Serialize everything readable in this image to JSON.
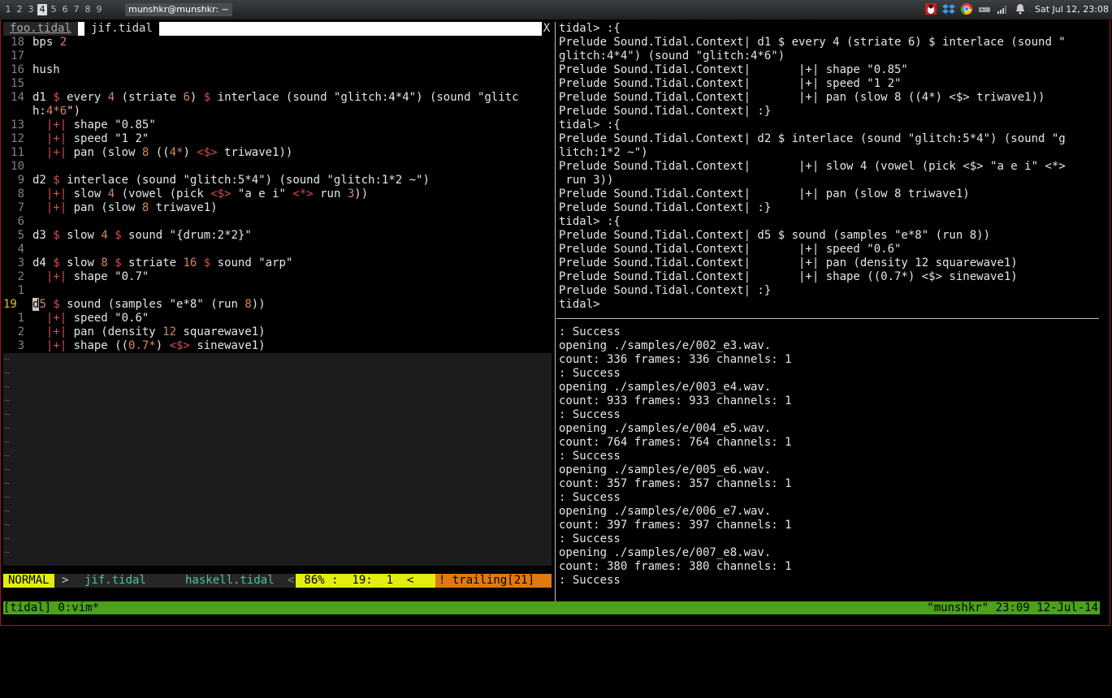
{
  "panel": {
    "workspaces": [
      "1",
      "2",
      "3",
      "4",
      "5",
      "6",
      "7",
      "8",
      "9"
    ],
    "active_workspace": "4",
    "window_title": "munshkr@munshkr: ~",
    "clock": "Sat Jul 12, 23:08",
    "tray_icons": [
      "tux-icon",
      "dropbox-icon",
      "chrome-icon",
      "drive-icon",
      "network-icon",
      "bell-icon"
    ]
  },
  "vim": {
    "tabs": [
      "foo.tidal",
      "jif.tidal"
    ],
    "close": "X",
    "status": {
      "mode": "NORMAL",
      "sep1": ">",
      "file1": "jif.tidal",
      "file2": "haskell.tidal",
      "sep2": "<",
      "position": " 86% :  19:  1  <",
      "warning": "! trailing[21]"
    }
  },
  "tmux": {
    "left": "[tidal] 0:vim*",
    "right": "\"munshkr\" 23:09 12-Jul-14"
  },
  "colors": {
    "status_yellow": "#e2ee10",
    "status_orange": "#e07a10",
    "tmux_green": "#4ca21a",
    "frame_red": "#a4161a"
  },
  "code_lines": [
    {
      "n": "18",
      "t": "bps 2"
    },
    {
      "n": "17",
      "t": ""
    },
    {
      "n": "16",
      "t": "hush"
    },
    {
      "n": "15",
      "t": ""
    },
    {
      "n": "14",
      "t": "d1 $ every 4 (striate 6) $ interlace (sound \"glitch:4*4\") (sound \"glitc"
    },
    {
      "n": "",
      "t": "h:4*6\")"
    },
    {
      "n": "13",
      "t": "  |+| shape \"0.85\""
    },
    {
      "n": "12",
      "t": "  |+| speed \"1 2\""
    },
    {
      "n": "11",
      "t": "  |+| pan (slow 8 ((4*) <$> triwave1))"
    },
    {
      "n": "10",
      "t": ""
    },
    {
      "n": "9",
      "t": "d2 $ interlace (sound \"glitch:5*4\") (sound \"glitch:1*2 ~\")"
    },
    {
      "n": "8",
      "t": "  |+| slow 4 (vowel (pick <$> \"a e i\" <*> run 3))"
    },
    {
      "n": "7",
      "t": "  |+| pan (slow 8 triwave1)"
    },
    {
      "n": "6",
      "t": ""
    },
    {
      "n": "5",
      "t": "d3 $ slow 4 $ sound \"{drum:2*2}\""
    },
    {
      "n": "4",
      "t": ""
    },
    {
      "n": "3",
      "t": "d4 $ slow 8 $ striate 16 $ sound \"arp\""
    },
    {
      "n": "2",
      "t": "  |+| shape \"0.7\""
    },
    {
      "n": "1",
      "t": ""
    },
    {
      "n": "19",
      "t": "d5 $ sound (samples \"e*8\" (run 8))"
    },
    {
      "n": "1",
      "t": "  |+| speed \"0.6\""
    },
    {
      "n": "2",
      "t": "  |+| pan (density 12 squarewave1)"
    },
    {
      "n": "3",
      "t": "  |+| shape ((0.7*) <$> sinewave1)"
    }
  ],
  "ghci_lines": [
    "tidal> :{",
    "Prelude Sound.Tidal.Context| d1 $ every 4 (striate 6) $ interlace (sound \"",
    "glitch:4*4\") (sound \"glitch:4*6\")",
    "Prelude Sound.Tidal.Context|       |+| shape \"0.85\"",
    "Prelude Sound.Tidal.Context|       |+| speed \"1 2\"",
    "Prelude Sound.Tidal.Context|       |+| pan (slow 8 ((4*) <$> triwave1))",
    "Prelude Sound.Tidal.Context| :}",
    "tidal> :{",
    "Prelude Sound.Tidal.Context| d2 $ interlace (sound \"glitch:5*4\") (sound \"g",
    "litch:1*2 ~\")",
    "Prelude Sound.Tidal.Context|       |+| slow 4 (vowel (pick <$> \"a e i\" <*>",
    " run 3))",
    "Prelude Sound.Tidal.Context|       |+| pan (slow 8 triwave1)",
    "Prelude Sound.Tidal.Context| :}",
    "tidal> :{",
    "Prelude Sound.Tidal.Context| d5 $ sound (samples \"e*8\" (run 8))",
    "Prelude Sound.Tidal.Context|       |+| speed \"0.6\"",
    "Prelude Sound.Tidal.Context|       |+| pan (density 12 squarewave1)",
    "Prelude Sound.Tidal.Context|       |+| shape ((0.7*) <$> sinewave1)",
    "Prelude Sound.Tidal.Context| :}",
    "tidal>"
  ],
  "log_lines": [
    ": Success",
    "opening ./samples/e/002_e3.wav.",
    "count: 336 frames: 336 channels: 1",
    ": Success",
    "opening ./samples/e/003_e4.wav.",
    "count: 933 frames: 933 channels: 1",
    ": Success",
    "opening ./samples/e/004_e5.wav.",
    "count: 764 frames: 764 channels: 1",
    ": Success",
    "opening ./samples/e/005_e6.wav.",
    "count: 357 frames: 357 channels: 1",
    ": Success",
    "opening ./samples/e/006_e7.wav.",
    "count: 397 frames: 397 channels: 1",
    ": Success",
    "opening ./samples/e/007_e8.wav.",
    "count: 380 frames: 380 channels: 1",
    ": Success"
  ]
}
